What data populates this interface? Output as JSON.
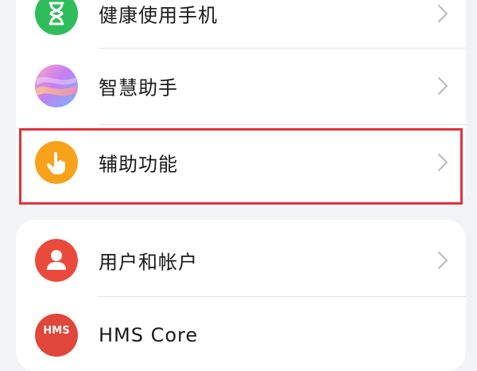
{
  "settings_group_1": {
    "items": [
      {
        "label": "健康使用手机",
        "icon": "hourglass-icon",
        "color": "#2fbd5c"
      },
      {
        "label": "智慧助手",
        "icon": "smart-assistant-icon",
        "color": "#c77df0"
      },
      {
        "label": "辅助功能",
        "icon": "accessibility-hand-icon",
        "color": "#f7a21a"
      }
    ]
  },
  "settings_group_2": {
    "items": [
      {
        "label": "用户和帐户",
        "icon": "user-icon",
        "color": "#ea4a3c"
      },
      {
        "label": "HMS Core",
        "icon": "hms-core-icon",
        "icon_text": "HMS",
        "color": "#e0473a"
      }
    ]
  },
  "highlight_color": "#e5303a"
}
